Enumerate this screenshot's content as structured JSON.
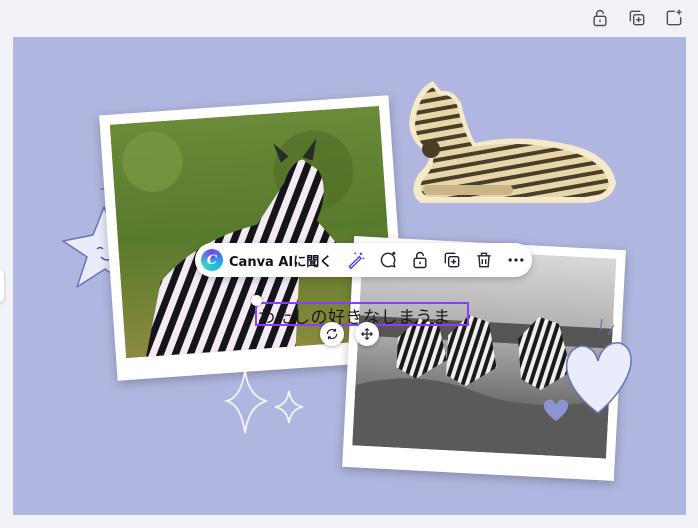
{
  "topbar": {
    "icons": [
      "lock-icon",
      "duplicate-icon",
      "add-page-icon"
    ]
  },
  "toolbar": {
    "ai_label": "Canva AIに聞く",
    "ai_logo_letter": "C",
    "icons": [
      "magic-edit-icon",
      "comment-icon",
      "lock-icon",
      "duplicate-icon",
      "trash-icon",
      "more-icon"
    ]
  },
  "textbox": {
    "text": "わたしの好きなしまうま"
  },
  "controls": {
    "icons": [
      "rotate-icon",
      "move-icon"
    ]
  },
  "colors": {
    "canvas_bg": "#b1b6e0",
    "selection": "#8b3dff",
    "doodle": "#e8ecfb",
    "doodle_stroke": "#6a72b8"
  }
}
